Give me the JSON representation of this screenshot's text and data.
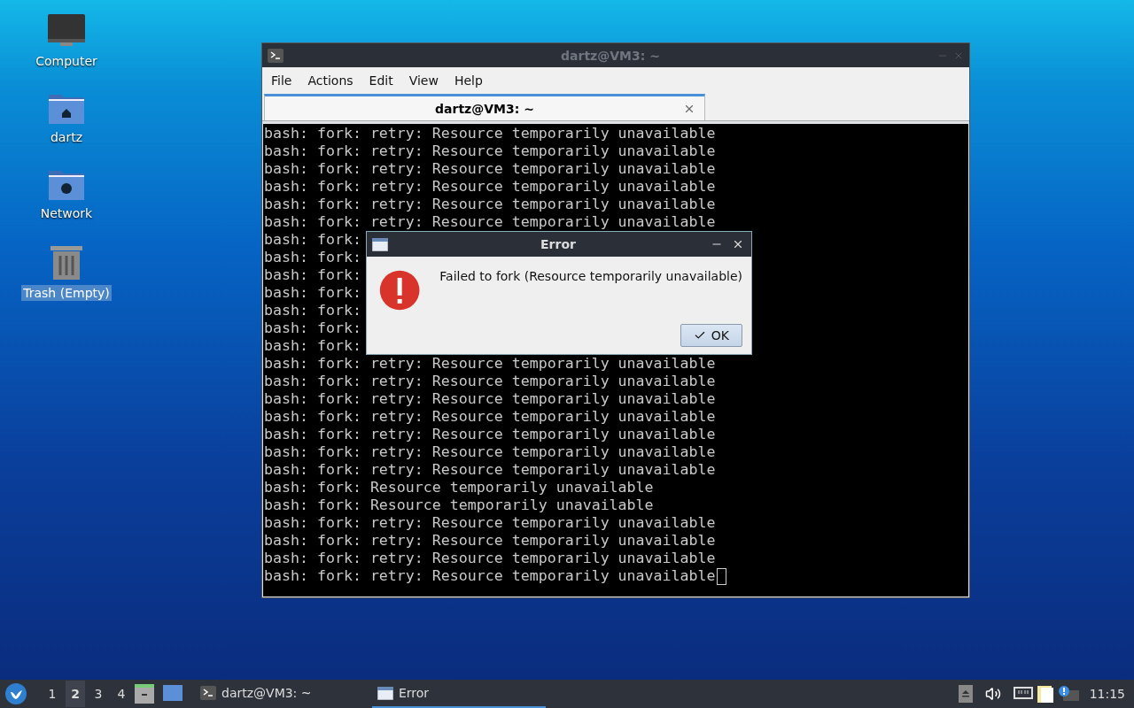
{
  "desktop": {
    "icons": [
      {
        "kind": "computer",
        "label": "Computer",
        "selected": false
      },
      {
        "kind": "home",
        "label": "dartz",
        "selected": false
      },
      {
        "kind": "network",
        "label": "Network",
        "selected": false
      },
      {
        "kind": "trash",
        "label": "Trash (Empty)",
        "selected": true
      }
    ]
  },
  "terminal": {
    "title": "dartz@VM3: ~",
    "menu": [
      "File",
      "Actions",
      "Edit",
      "View",
      "Help"
    ],
    "tab": {
      "label": "dartz@VM3: ~",
      "selected": true
    },
    "lines": [
      "bash: fork: retry: Resource temporarily unavailable",
      "bash: fork: retry: Resource temporarily unavailable",
      "bash: fork: retry: Resource temporarily unavailable",
      "bash: fork: retry: Resource temporarily unavailable",
      "bash: fork: retry: Resource temporarily unavailable",
      "bash: fork: retry: Resource temporarily unavailable",
      "bash: fork:",
      "bash: fork:",
      "bash: fork:",
      "bash: fork:",
      "bash: fork:",
      "bash: fork:",
      "bash: fork:",
      "bash: fork: retry: Resource temporarily unavailable",
      "bash: fork: retry: Resource temporarily unavailable",
      "bash: fork: retry: Resource temporarily unavailable",
      "bash: fork: retry: Resource temporarily unavailable",
      "bash: fork: retry: Resource temporarily unavailable",
      "bash: fork: retry: Resource temporarily unavailable",
      "bash: fork: retry: Resource temporarily unavailable",
      "bash: fork: Resource temporarily unavailable",
      "bash: fork: Resource temporarily unavailable",
      "bash: fork: retry: Resource temporarily unavailable",
      "bash: fork: retry: Resource temporarily unavailable",
      "bash: fork: retry: Resource temporarily unavailable",
      "bash: fork: retry: Resource temporarily unavailable"
    ]
  },
  "dialog": {
    "title": "Error",
    "message": "Failed to fork (Resource temporarily unavailable)",
    "button": "OK"
  },
  "taskbar": {
    "workspaces": [
      {
        "label": "1",
        "selected": false
      },
      {
        "label": "2",
        "selected": true
      },
      {
        "label": "3",
        "selected": false
      },
      {
        "label": "4",
        "selected": false
      }
    ],
    "tasks": [
      {
        "kind": "terminal",
        "label": "dartz@VM3: ~",
        "selected": false
      },
      {
        "kind": "window",
        "label": "Error",
        "selected": true
      }
    ],
    "clock": "11:15"
  }
}
